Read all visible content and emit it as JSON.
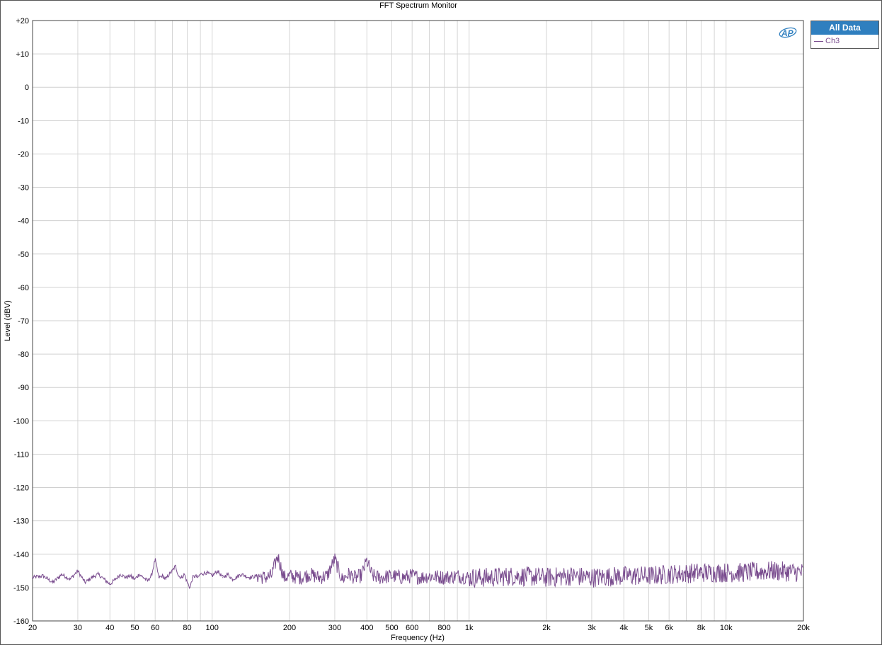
{
  "chart_data": {
    "type": "line",
    "title": "FFT Spectrum Monitor",
    "xlabel": "Frequency (Hz)",
    "ylabel": "Level (dBV)",
    "xscale": "log",
    "xlim": [
      20,
      20000
    ],
    "ylim": [
      -160,
      20
    ],
    "grid": true,
    "legend_position": "right",
    "x_ticks": [
      20,
      30,
      40,
      50,
      60,
      80,
      100,
      200,
      300,
      400,
      500,
      600,
      800,
      1000,
      2000,
      3000,
      4000,
      5000,
      6000,
      8000,
      10000,
      20000
    ],
    "x_tick_labels": [
      "20",
      "30",
      "40",
      "50",
      "60",
      "80",
      "100",
      "200",
      "300",
      "400",
      "500",
      "600",
      "800",
      "1k",
      "2k",
      "3k",
      "4k",
      "5k",
      "6k",
      "8k",
      "10k",
      "20k"
    ],
    "y_ticks": [
      20,
      10,
      0,
      -10,
      -20,
      -30,
      -40,
      -50,
      -60,
      -70,
      -80,
      -90,
      -100,
      -110,
      -120,
      -130,
      -140,
      -150,
      -160
    ],
    "y_tick_labels": [
      "+20",
      "+10",
      "0",
      "-10",
      "-20",
      "-30",
      "-40",
      "-50",
      "-60",
      "-70",
      "-80",
      "-90",
      "-100",
      "-110",
      "-120",
      "-130",
      "-140",
      "-150",
      "-160"
    ],
    "series": [
      {
        "name": "Ch3",
        "color": "#7a4d8f",
        "x": [
          20,
          22,
          24,
          26,
          28,
          30,
          32,
          34,
          36,
          38,
          40,
          42,
          44,
          46,
          48,
          50,
          52,
          54,
          56,
          58,
          60,
          62,
          64,
          66,
          68,
          70,
          72,
          74,
          76,
          78,
          80,
          82,
          84,
          86,
          88,
          90,
          95,
          100,
          105,
          110,
          115,
          120,
          130,
          140,
          150,
          160,
          170,
          180,
          190,
          200,
          220,
          240,
          260,
          280,
          300,
          320,
          340,
          360,
          380,
          400,
          420,
          450,
          500,
          550,
          600,
          650,
          700,
          800,
          900,
          1000,
          1200,
          1500,
          2000,
          2500,
          3000,
          4000,
          5000,
          6000,
          8000,
          10000,
          12000,
          15000,
          20000
        ],
        "y": [
          -147,
          -146.5,
          -148.5,
          -146,
          -147.5,
          -145,
          -148.5,
          -147,
          -146,
          -147.5,
          -149,
          -147.5,
          -146,
          -147,
          -146.5,
          -147.5,
          -146,
          -147,
          -148,
          -146.5,
          -141.5,
          -147,
          -146.5,
          -147.5,
          -146,
          -145,
          -143.5,
          -146.5,
          -147,
          -146,
          -148.5,
          -150,
          -147,
          -146.5,
          -147,
          -146,
          -145.5,
          -146.5,
          -145,
          -147,
          -146,
          -147.5,
          -146,
          -147,
          -146.5,
          -147,
          -146.5,
          -140.5,
          -147,
          -146.5,
          -147,
          -146,
          -147,
          -146.5,
          -141.5,
          -147.5,
          -146,
          -147,
          -146.5,
          -142,
          -146.5,
          -147,
          -146.5,
          -147,
          -146.5,
          -147,
          -146.5,
          -147,
          -146.5,
          -147,
          -147,
          -146.5,
          -147,
          -146.5,
          -147,
          -146.5,
          -146.5,
          -146,
          -145.5,
          -145.5,
          -145.5,
          -145,
          -145.5
        ]
      }
    ]
  },
  "legend": {
    "header": "All Data",
    "items": [
      {
        "label": "Ch3",
        "color": "#7a4d8f"
      }
    ]
  },
  "logo": "AP"
}
